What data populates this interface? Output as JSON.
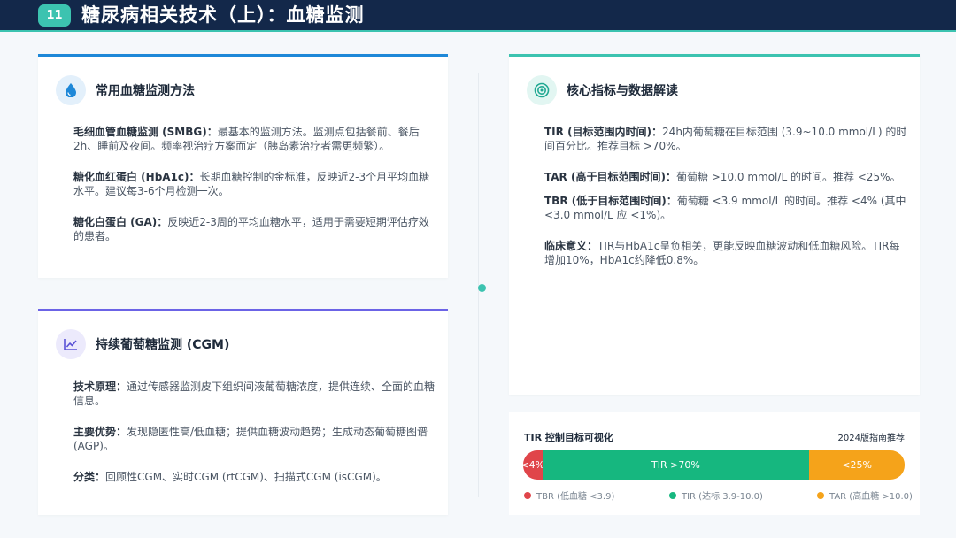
{
  "header": {
    "page_number": "11",
    "title": "糖尿病相关技术（上）：血糖监测"
  },
  "colors": {
    "accent": "#3cc3b0",
    "header_bg": "#13284a",
    "blue_bar": "#1e88d8",
    "purple_bar": "#6b63e6",
    "teal_bar": "#3cc3b0",
    "tbr": "#e0454a",
    "tir": "#16b77f",
    "tar": "#f5a31a"
  },
  "card_methods": {
    "icon": "water-drop-icon",
    "title": "常用血糖监测方法",
    "items": [
      {
        "term": "毛细血管血糖监测 (SMBG)：",
        "text": "最基本的监测方法。监测点包括餐前、餐后2h、睡前及夜间。频率视治疗方案而定（胰岛素治疗者需更频繁）。"
      },
      {
        "term": "糖化血红蛋白 (HbA1c)：",
        "text": "长期血糖控制的金标准，反映近2-3个月平均血糖水平。建议每3-6个月检测一次。"
      },
      {
        "term": "糖化白蛋白 (GA)：",
        "text": "反映近2-3周的平均血糖水平，适用于需要短期评估疗效的患者。"
      }
    ]
  },
  "card_cgm": {
    "icon": "line-chart-icon",
    "title": "持续葡萄糖监测 (CGM)",
    "items": [
      {
        "term": "技术原理：",
        "text": "通过传感器监测皮下组织间液葡萄糖浓度，提供连续、全面的血糖信息。"
      },
      {
        "term": "主要优势：",
        "text": "发现隐匿性高/低血糖；提供血糖波动趋势；生成动态葡萄糖图谱 (AGP)。"
      },
      {
        "term": "分类：",
        "text": "回顾性CGM、实时CGM (rtCGM)、扫描式CGM (isCGM)。"
      }
    ]
  },
  "card_metrics": {
    "icon": "target-icon",
    "title": "核心指标与数据解读",
    "items": [
      {
        "term": "TIR (目标范围内时间)：",
        "text": "24h内葡萄糖在目标范围 (3.9~10.0 mmol/L) 的时间百分比。推荐目标 >70%。"
      },
      {
        "term": "TAR (高于目标范围时间)：",
        "text": "葡萄糖 >10.0 mmol/L 的时间。推荐 <25%。"
      },
      {
        "term": "TBR (低于目标范围时间)：",
        "text": "葡萄糖 <3.9 mmol/L 的时间。推荐 <4% (其中 <3.0 mmol/L 应 <1%)。"
      },
      {
        "term": "临床意义：",
        "text": "TIR与HbA1c呈负相关，更能反映血糖波动和低血糖风险。TIR每增加10%，HbA1c约降低0.8%。"
      }
    ]
  },
  "viz": {
    "title": "TIR 控制目标可视化",
    "note": "2024版指南推荐",
    "segments": [
      {
        "label": "<4%",
        "share": 0.05
      },
      {
        "label": "TIR >70%",
        "share": 0.7
      },
      {
        "label": "<25%",
        "share": 0.25
      }
    ],
    "legend": [
      {
        "label": "TBR (低血糖 <3.9)"
      },
      {
        "label": "TIR (达标 3.9-10.0)"
      },
      {
        "label": "TAR (高血糖 >10.0)"
      }
    ]
  }
}
